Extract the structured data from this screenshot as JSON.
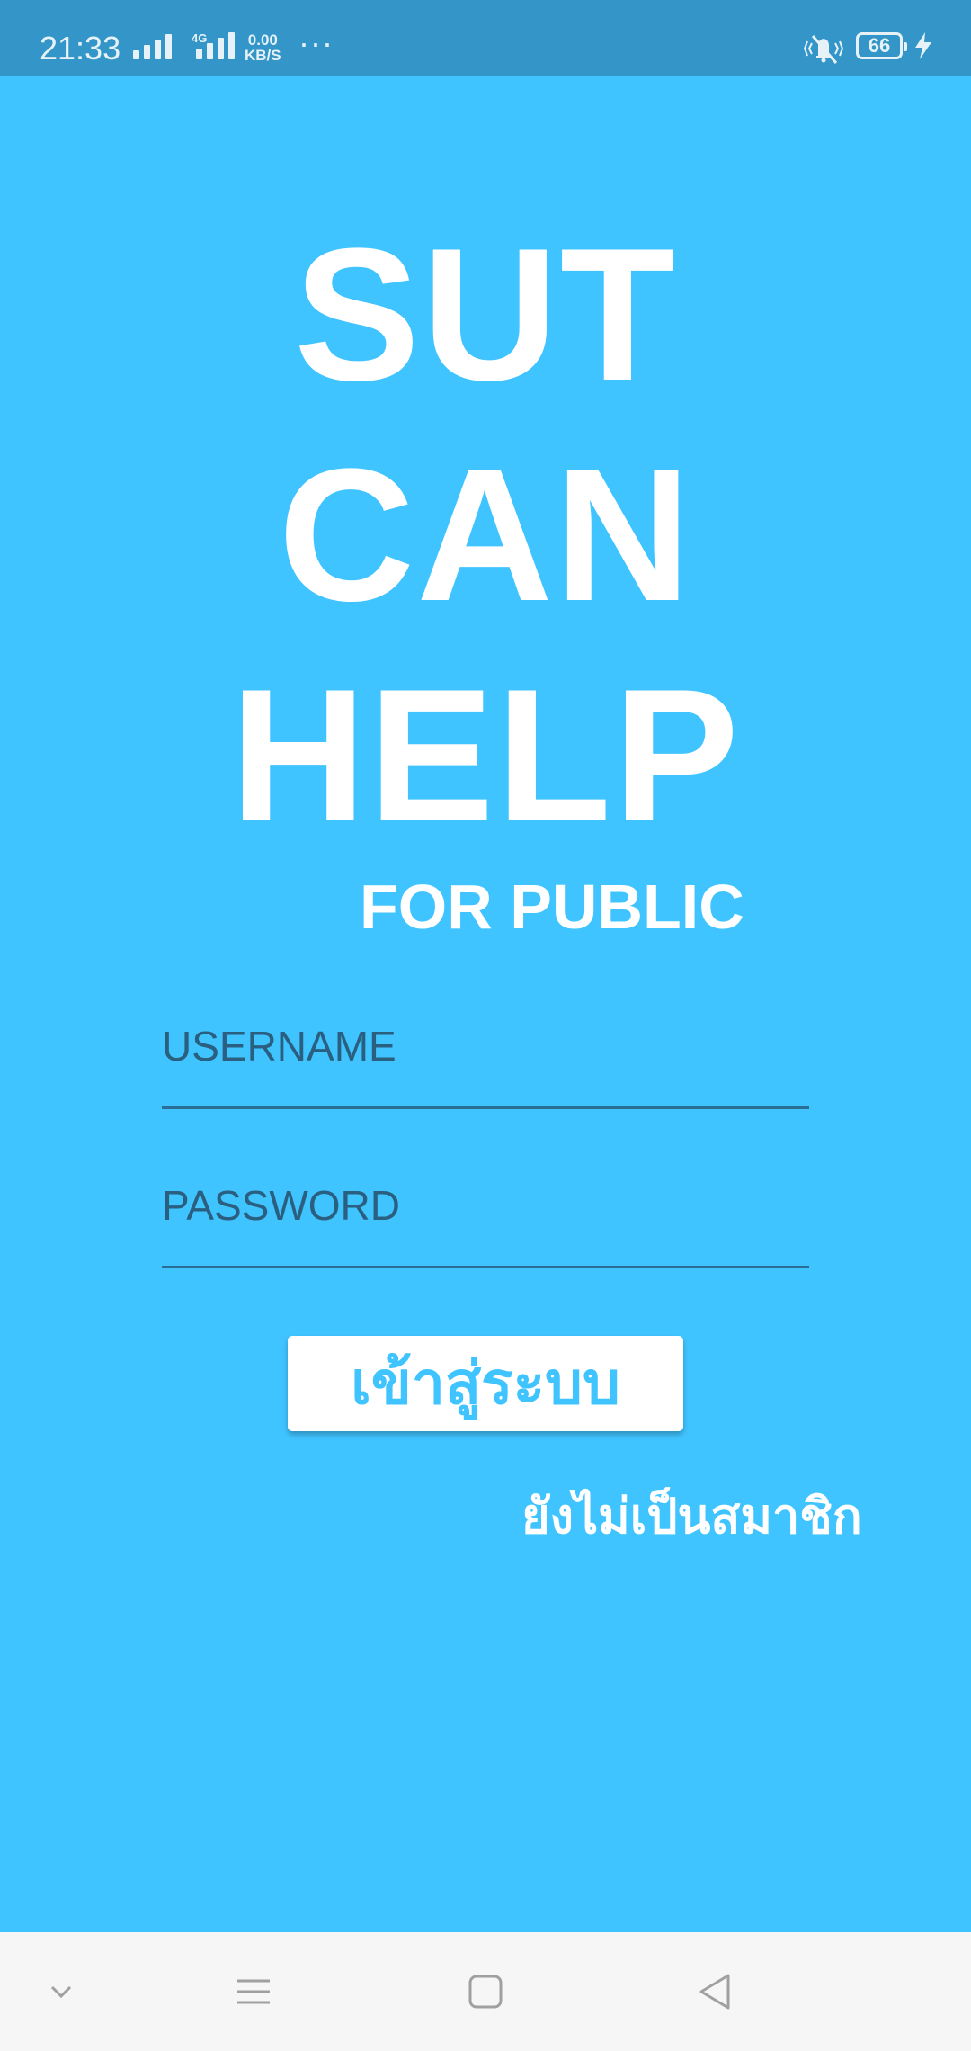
{
  "status_bar": {
    "time": "21:33",
    "network_type": "4G",
    "data_speed_value": "0.00",
    "data_speed_unit": "KB/S",
    "overflow": "···",
    "battery_level": "66",
    "icons": [
      "signal-icon",
      "signal-4g-icon",
      "more-dots-icon",
      "vibrate-bell-muted-icon",
      "battery-icon",
      "charging-bolt-icon"
    ]
  },
  "hero": {
    "line1": "SUT",
    "line2": "CAN",
    "line3": "HELP",
    "subtitle": "FOR PUBLIC"
  },
  "form": {
    "username_placeholder": "USERNAME",
    "username_value": "",
    "password_placeholder": "PASSWORD",
    "password_value": "",
    "login_label": "เข้าสู่ระบบ",
    "register_label": "ยังไม่เป็นสมาชิก"
  },
  "nav_bar": {
    "icons": [
      "collapse-chevron-icon",
      "menu-icon",
      "home-square-icon",
      "back-triangle-icon"
    ]
  },
  "colors": {
    "background": "#40C4FF",
    "status_bar": "#3496C8",
    "field_underline": "#2A6E96",
    "button_bg": "#FFFFFF",
    "nav_bar": "#F6F6F6"
  }
}
